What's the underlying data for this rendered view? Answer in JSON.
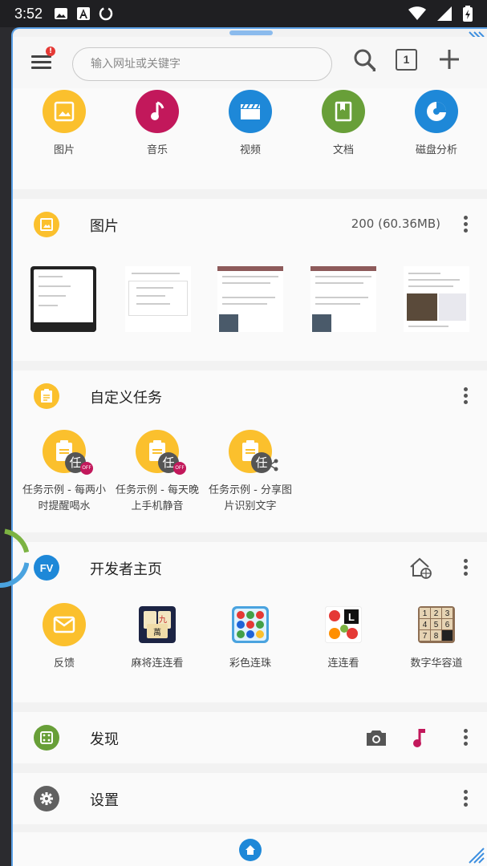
{
  "status_bar": {
    "time": "3:52"
  },
  "toolbar": {
    "search_placeholder": "输入网址或关键字",
    "tab_count": "1",
    "menu_badge": "!"
  },
  "shortcuts": [
    {
      "label": "图片",
      "icon": "image-icon",
      "color": "#fbc02d"
    },
    {
      "label": "音乐",
      "icon": "music-note-icon",
      "color": "#c2185b"
    },
    {
      "label": "视频",
      "icon": "clapperboard-icon",
      "color": "#1e88d8"
    },
    {
      "label": "文档",
      "icon": "book-icon",
      "color": "#689f38"
    },
    {
      "label": "磁盘分析",
      "icon": "disk-chart-icon",
      "color": "#1e88d8"
    }
  ],
  "images_card": {
    "title": "图片",
    "stats": "200 (60.36MB)"
  },
  "tasks_card": {
    "title": "自定义任务",
    "task_badge": "任",
    "off_badge": "OFF",
    "items": [
      {
        "label": "任务示例 - 每两小时提醒喝水"
      },
      {
        "label": "任务示例 - 每天晚上手机静音"
      },
      {
        "label": "任务示例 - 分享图片识别文字"
      }
    ]
  },
  "dev_card": {
    "title": "开发者主页",
    "logo_text": "FV",
    "items": [
      {
        "label": "反馈"
      },
      {
        "label": "麻将连连看"
      },
      {
        "label": "彩色连珠"
      },
      {
        "label": "连连看"
      },
      {
        "label": "数字华容道"
      }
    ]
  },
  "discover_card": {
    "title": "发现"
  },
  "settings_card": {
    "title": "设置"
  },
  "colors": {
    "accent_blue": "#1e88d8",
    "yellow": "#fbc02d",
    "magenta": "#c2185b",
    "green": "#689f38"
  }
}
